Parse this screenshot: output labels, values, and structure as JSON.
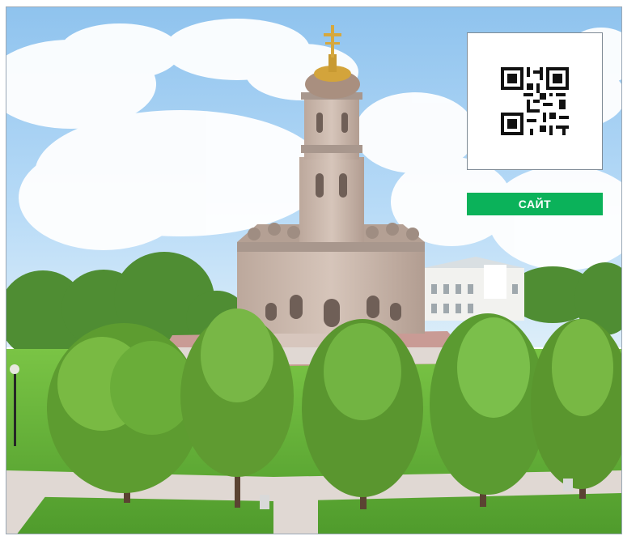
{
  "site_button": {
    "label": "САЙТ"
  },
  "qr_code": {
    "icon": "qr-code-icon"
  },
  "photo": {
    "subject": "church-with-trees",
    "colors": {
      "sky": "#8fc3ee",
      "cloud": "#ffffff",
      "grass": "#69b53b",
      "tree": "#5c9c2f",
      "stone": "#cbb8aa"
    }
  }
}
